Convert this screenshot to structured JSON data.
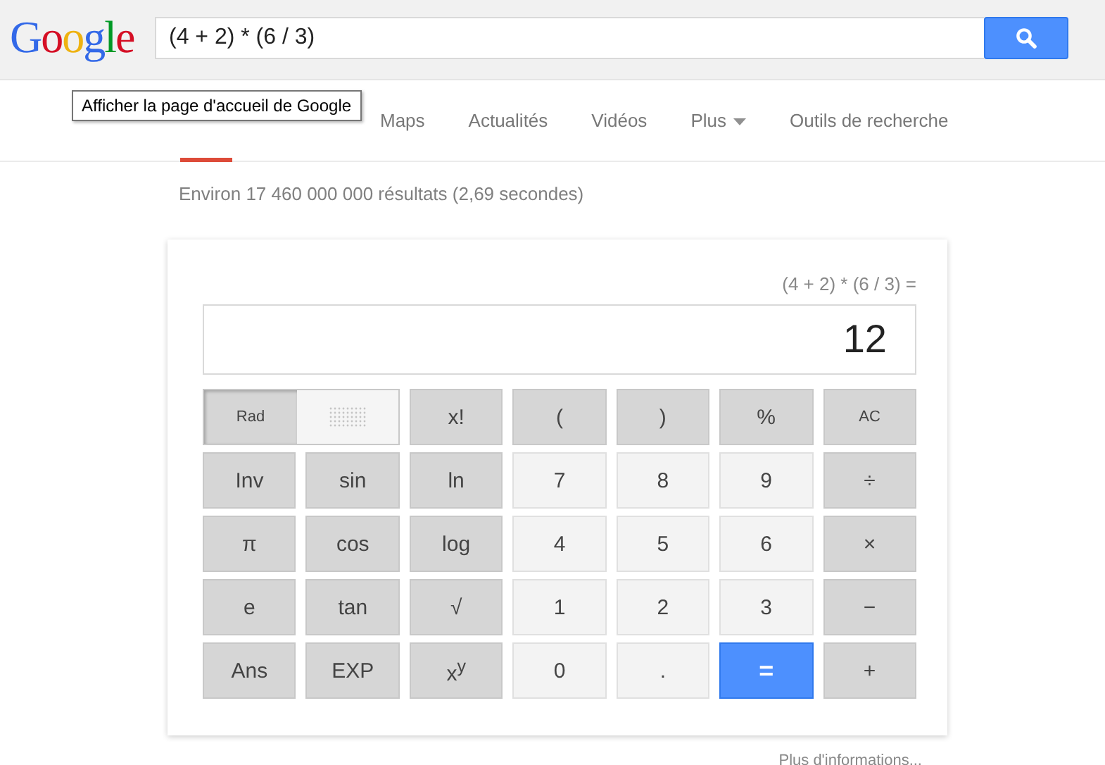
{
  "logo": "Google",
  "search": {
    "value": "(4 + 2) * (6 / 3)"
  },
  "tooltip": "Afficher la page d'accueil de Google",
  "tabs": [
    {
      "selected": true
    },
    {
      "selected": false
    },
    {
      "label": "Maps",
      "selected": false
    },
    {
      "label": "Actualités",
      "selected": false
    },
    {
      "label": "Vidéos",
      "selected": false
    },
    {
      "label": "Plus",
      "selected": false,
      "dropdown": true
    },
    {
      "label": "Outils de recherche",
      "selected": false
    }
  ],
  "result_stats": "Environ 17 460 000 000 résultats (2,69 secondes)",
  "calculator": {
    "expression": "(4 + 2) * (6 / 3) =",
    "display": "12",
    "angle_mode": [
      {
        "label": "Rad",
        "selected": true
      },
      {
        "selected": false
      }
    ],
    "keys": [
      {
        "label": "x!",
        "kind": "func"
      },
      {
        "label": "(",
        "kind": "func"
      },
      {
        "label": ")",
        "kind": "func"
      },
      {
        "label": "%",
        "kind": "func"
      },
      {
        "label": "AC",
        "kind": "small"
      },
      {
        "label": "Inv",
        "kind": "func"
      },
      {
        "label": "sin",
        "kind": "func"
      },
      {
        "label": "ln",
        "kind": "func"
      },
      {
        "label": "7",
        "kind": "num"
      },
      {
        "label": "8",
        "kind": "num"
      },
      {
        "label": "9",
        "kind": "num"
      },
      {
        "label": "÷",
        "kind": "func"
      },
      {
        "label": "π",
        "kind": "func"
      },
      {
        "label": "cos",
        "kind": "func"
      },
      {
        "label": "log",
        "kind": "func"
      },
      {
        "label": "4",
        "kind": "num"
      },
      {
        "label": "5",
        "kind": "num"
      },
      {
        "label": "6",
        "kind": "num"
      },
      {
        "label": "×",
        "kind": "func"
      },
      {
        "label": "e",
        "kind": "func"
      },
      {
        "label": "tan",
        "kind": "func"
      },
      {
        "label": "√",
        "kind": "func"
      },
      {
        "label": "1",
        "kind": "num"
      },
      {
        "label": "2",
        "kind": "num"
      },
      {
        "label": "3",
        "kind": "num"
      },
      {
        "label": "−",
        "kind": "func"
      },
      {
        "label": "Ans",
        "kind": "func"
      },
      {
        "label": "EXP",
        "kind": "func"
      },
      {
        "label": "x$^{y}$",
        "kind": "func"
      },
      {
        "label": "0",
        "kind": "num"
      },
      {
        "label": ".",
        "kind": "num"
      },
      {
        "label": "=",
        "kind": "equals"
      },
      {
        "label": "+",
        "kind": "func"
      }
    ]
  },
  "more_info": "Plus d'informations..."
}
